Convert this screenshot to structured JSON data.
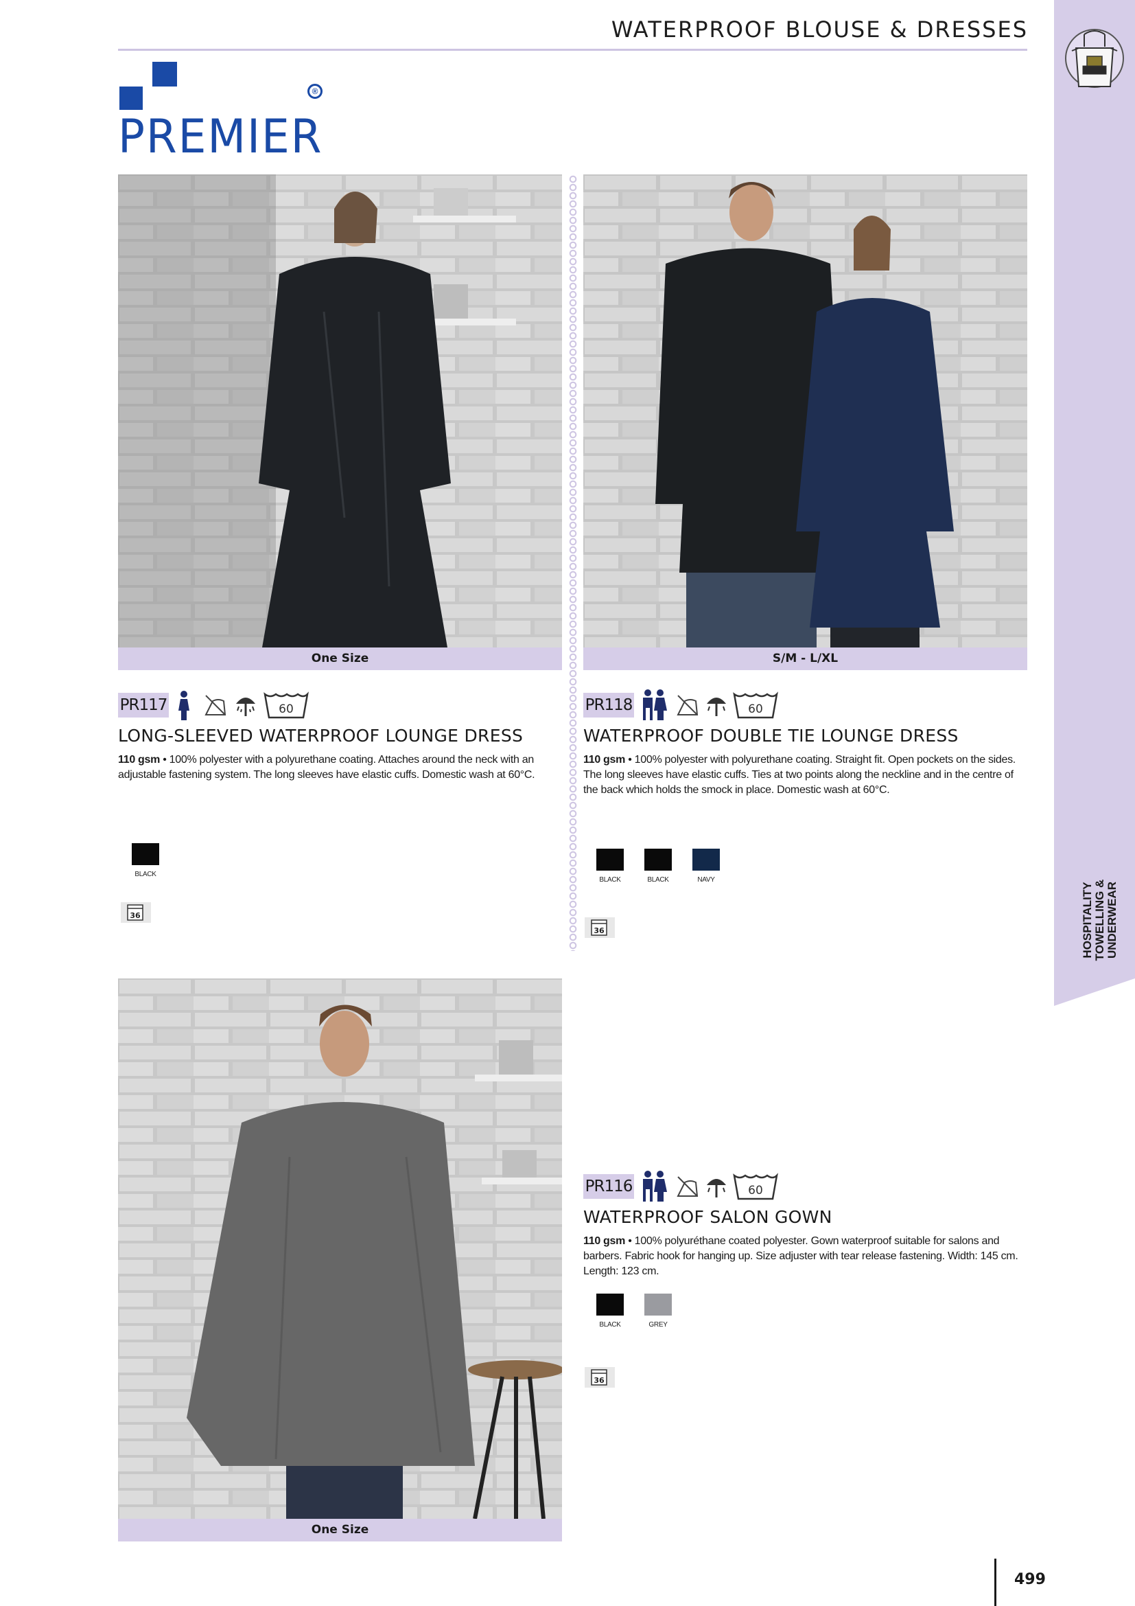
{
  "header": {
    "title": "WATERPROOF BLOUSE & DRESSES"
  },
  "logo": {
    "text": "PREMIER",
    "registered": "®",
    "color": "#1a4aa6"
  },
  "side_label": {
    "line1": "HOSPITALITY",
    "line2": "TOWELLING &",
    "line3": "UNDERWEAR",
    "icon": "apron-icon"
  },
  "accent_color": "#d6cde8",
  "products": [
    {
      "code": "PR117",
      "size": "One Size",
      "title": "LONG-SLEEVED WATERPROOF LOUNGE DRESS",
      "weight": "110 gsm",
      "description": " • 100% polyester with a polyurethane coating. Attaches around the neck with an adjustable fastening system. The long sleeves have elastic cuffs. Domestic wash at 60°C.",
      "icons": [
        "female-fit-icon",
        "no-iron-icon",
        "waterproof-icon",
        "wash-60-icon"
      ],
      "wash_temp": "60",
      "colours": [
        {
          "name": "BLACK",
          "hex": "#0a0a0a"
        }
      ],
      "pack": "36"
    },
    {
      "code": "PR118",
      "size": "S/M - L/XL",
      "title": "WATERPROOF DOUBLE TIE LOUNGE DRESS",
      "weight": "110 gsm",
      "description": " • 100% polyester with polyurethane coating. Straight fit. Open pockets on the sides. The long sleeves have elastic cuffs. Ties at two points along the neckline and in the centre of the back which holds the smock in place. Domestic wash at 60°C.",
      "icons": [
        "unisex-fit-icon",
        "no-iron-icon",
        "waterproof-icon",
        "wash-60-icon"
      ],
      "wash_temp": "60",
      "colours": [
        {
          "name": "BLACK",
          "hex": "#0a0a0a"
        },
        {
          "name": "BLACK",
          "hex": "#0a0a0a"
        },
        {
          "name": "NAVY",
          "hex": "#12294a"
        }
      ],
      "pack": "36"
    },
    {
      "code": "PR116",
      "size": "One Size",
      "title": "WATERPROOF SALON GOWN",
      "weight": "110 gsm",
      "description": " • 100% polyuréthane coated polyester. Gown waterproof suitable for salons and barbers. Fabric hook for hanging up. Size adjuster with tear release fastening. Width: 145 cm. Length: 123 cm.",
      "icons": [
        "unisex-fit-icon",
        "no-iron-icon",
        "waterproof-icon",
        "wash-60-icon"
      ],
      "wash_temp": "60",
      "colours": [
        {
          "name": "BLACK",
          "hex": "#0a0a0a"
        },
        {
          "name": "GREY",
          "hex": "#9a9ba0"
        }
      ],
      "pack": "36"
    }
  ],
  "page_number": "499"
}
